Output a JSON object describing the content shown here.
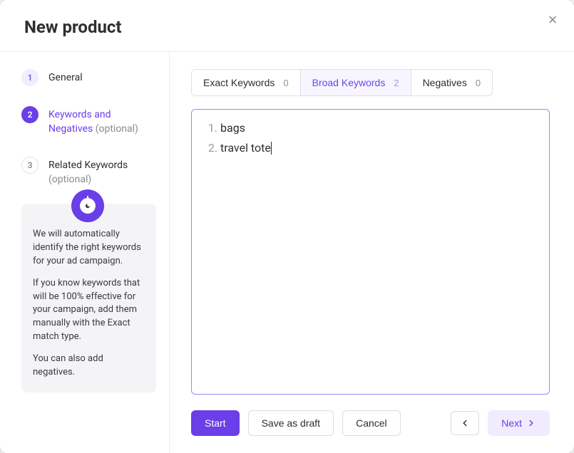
{
  "modal": {
    "title": "New product",
    "close_icon": "×"
  },
  "steps": [
    {
      "num": "1",
      "title": "General",
      "optional": ""
    },
    {
      "num": "2",
      "title": "Keywords and Negatives",
      "optional": "(optional)"
    },
    {
      "num": "3",
      "title": "Related Keywords",
      "optional": "(optional)"
    }
  ],
  "info": {
    "p1": "We will automatically identify the right keywords for your ad campaign.",
    "p2": "If you know keywords that will be 100% effective for your campaign, add them manually with the Exact match type.",
    "p3": "You can also add negatives."
  },
  "tabs": {
    "exact": {
      "label": "Exact Keywords",
      "count": "0"
    },
    "broad": {
      "label": "Broad Keywords",
      "count": "2"
    },
    "negatives": {
      "label": "Negatives",
      "count": "0"
    }
  },
  "keywords": {
    "items": [
      "bags",
      "travel tote"
    ]
  },
  "buttons": {
    "start": "Start",
    "save_draft": "Save as draft",
    "cancel": "Cancel",
    "next": "Next"
  }
}
